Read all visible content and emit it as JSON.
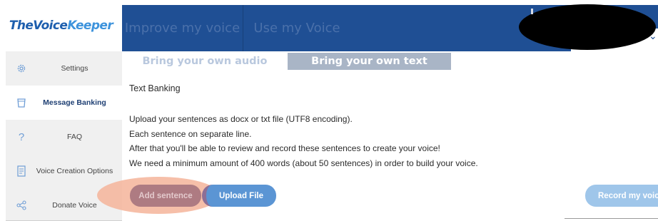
{
  "brand": {
    "name_part1": "TheVoice",
    "name_part2": "Keeper"
  },
  "header": {
    "tabs": [
      {
        "label": "Improve my voice"
      },
      {
        "label": "Use my Voice"
      }
    ],
    "user_menu": {
      "icon": "chevron-down-icon"
    }
  },
  "sidebar": {
    "items": [
      {
        "label": "Settings",
        "icon": "gear-icon"
      },
      {
        "label": "Message Banking",
        "icon": "cup-icon",
        "active": true
      },
      {
        "label": "FAQ",
        "icon": "question-icon"
      },
      {
        "label": "Voice Creation Options",
        "icon": "document-icon"
      },
      {
        "label": "Donate Voice",
        "icon": "share-icon"
      }
    ]
  },
  "subtabs": [
    {
      "label": "Bring your own audio"
    },
    {
      "label": "Bring your own text",
      "active": true
    }
  ],
  "content": {
    "title": "Text Banking",
    "lines": [
      "Upload your sentences as docx or txt file (UTF8 encoding).",
      "Each sentence on separate line.",
      "After that you'll be able to review and record these sentences to create your voice!",
      "We need a minimum amount of 400 words (about 50 sentences) in order to build your voice."
    ]
  },
  "buttons": {
    "add_sentence": "Add sentence",
    "upload_file": "Upload File",
    "record": "Record my voice"
  },
  "colors": {
    "header": "#1f4f94",
    "brand_blue": "#1e5fae",
    "active_subtab": "#a9b5c6",
    "upload_button": "#5b95d4",
    "highlight": "#f4b49a"
  }
}
